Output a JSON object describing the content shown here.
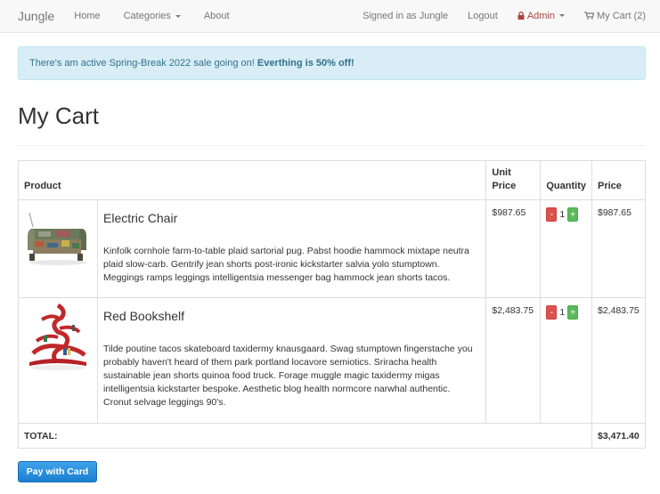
{
  "navbar": {
    "brand": "Jungle",
    "left_links": [
      {
        "label": "Home"
      },
      {
        "label": "Categories"
      },
      {
        "label": "About"
      }
    ],
    "signed_in": "Signed in as Jungle",
    "logout": "Logout",
    "admin": "Admin",
    "cart": "My Cart (2)",
    "icons": {
      "admin": "lock-icon",
      "cart": "shopping-cart-icon"
    },
    "colors": {
      "admin": "#a94442"
    }
  },
  "alert": {
    "text": "There's am active Spring-Break 2022 sale going on! ",
    "emphasis": "Everthing is 50% off!"
  },
  "page": {
    "title": "My Cart"
  },
  "table": {
    "headers": {
      "product": "Product",
      "unit_price": "Unit Price",
      "quantity": "Quantity",
      "price": "Price"
    },
    "items": [
      {
        "name": "Electric Chair",
        "description": "Kinfolk cornhole farm-to-table plaid sartorial pug. Pabst hoodie hammock mixtape neutra plaid slow-carb. Gentrify jean shorts post-ironic kickstarter salvia yolo stumptown. Meggings ramps leggings intelligentsia messenger bag hammock jean shorts tacos.",
        "unit_price": "$987.65",
        "quantity": "1",
        "price": "$987.65"
      },
      {
        "name": "Red Bookshelf",
        "description": "Tilde poutine tacos skateboard taxidermy knausgaard. Swag stumptown fingerstache you probably haven't heard of them park portland locavore semiotics. Sriracha health sustainable jean shorts quinoa food truck. Forage muggle magic taxidermy migas intelligentsia kickstarter bespoke. Aesthetic blog health normcore narwhal authentic. Cronut selvage leggings 90's.",
        "unit_price": "$2,483.75",
        "quantity": "1",
        "price": "$2,483.75"
      }
    ],
    "buttons": {
      "minus": "-",
      "plus": "+"
    },
    "total_label": "TOTAL:",
    "total_value": "$3,471.40"
  },
  "pay_button": "Pay with Card",
  "colors": {
    "alert_bg": "#d9edf7",
    "alert_text": "#31708f",
    "pay_button": "#1f87d6"
  }
}
